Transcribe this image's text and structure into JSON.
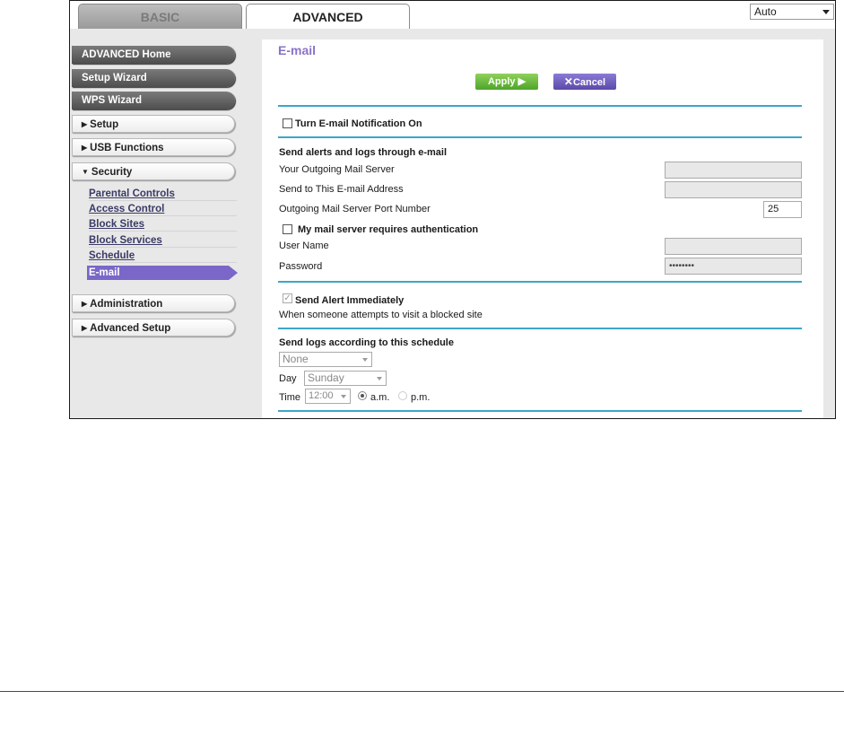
{
  "tabs": {
    "basic": "BASIC",
    "advanced": "ADVANCED"
  },
  "language": {
    "selected": "Auto"
  },
  "nav": {
    "advanced_home": "ADVANCED Home",
    "setup_wizard": "Setup Wizard",
    "wps_wizard": "WPS Wizard",
    "setup": "Setup",
    "usb_functions": "USB Functions",
    "security": "Security",
    "security_items": [
      "Parental Controls",
      "Access Control",
      "Block Sites",
      "Block Services",
      "Schedule"
    ],
    "active_item": "E-mail",
    "administration": "Administration",
    "advanced_setup": "Advanced Setup"
  },
  "page": {
    "title": "E-mail",
    "apply": "Apply ▶",
    "cancel": "Cancel",
    "notification_label": "Turn E-mail Notification On",
    "notification_checked": false,
    "section_alerts": "Send alerts and logs through e-mail",
    "outgoing_server_label": "Your Outgoing Mail Server",
    "outgoing_server_value": "",
    "send_to_label": "Send to This E-mail Address",
    "send_to_value": "",
    "port_label": "Outgoing Mail Server Port Number",
    "port_value": "25",
    "auth_label": "My mail server requires authentication",
    "auth_checked": false,
    "username_label": "User Name",
    "username_value": "",
    "password_label": "Password",
    "password_value": "••••••••",
    "send_alert_label": "Send Alert Immediately",
    "send_alert_checked": true,
    "send_alert_desc": "When someone attempts to visit a blocked site",
    "schedule_section": "Send logs according to this schedule",
    "schedule_value": "None",
    "day_label": "Day",
    "day_value": "Sunday",
    "time_label": "Time",
    "time_value": "12:00",
    "am_label": "a.m.",
    "pm_label": "p.m.",
    "am_selected": true
  },
  "colors": {
    "accent_purple": "#8a73c9",
    "rule_blue": "#3da6c8",
    "apply_green": "#6cbb3c",
    "cancel_purple": "#6f5ec0"
  }
}
